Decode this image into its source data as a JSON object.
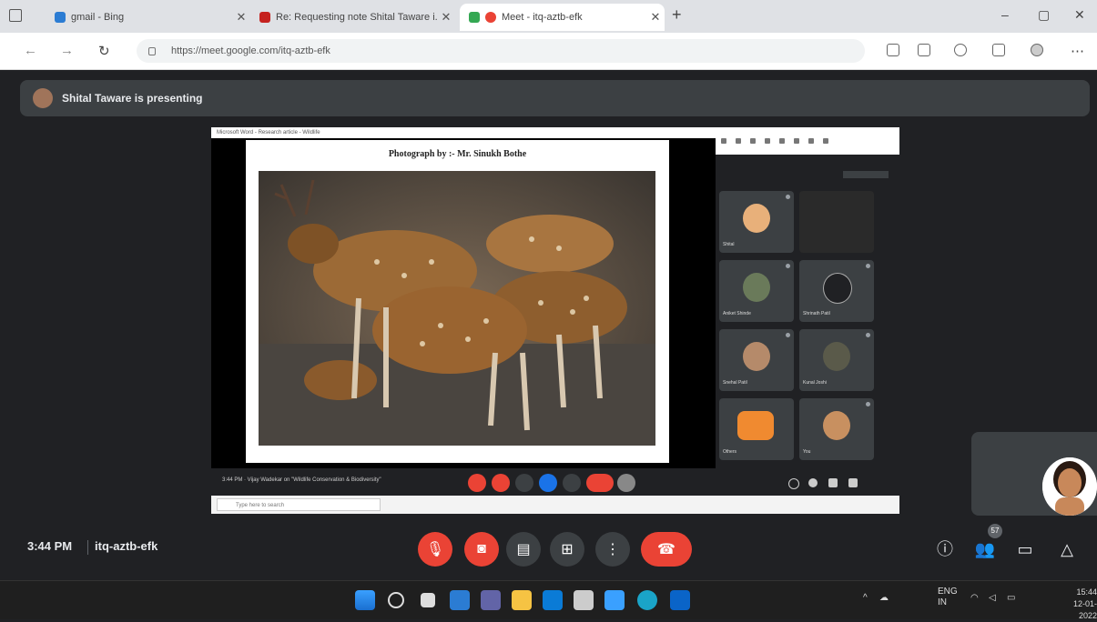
{
  "browser": {
    "tabs": [
      {
        "title": "gmail - Bing"
      },
      {
        "title": "Re: Requesting note Shital Taware i..."
      },
      {
        "title": "Meet - itq-aztb-efk"
      }
    ],
    "address": "https://meet.google.com/itq-aztb-efk"
  },
  "meet": {
    "presenting_text": "Shital Taware is presenting",
    "slide_caption": "Photograph by :- Mr. Sinukh Bothe",
    "time": "3:44 PM",
    "meeting_code": "itq-aztb-efk",
    "participant_count": "57"
  },
  "inner": {
    "window_title": "Microsoft Word - Research article - Wildlife",
    "strip_text": "3:44 PM  ·  Vijay Wadekar on \"Wildlife Conservation & Biodiversity\"",
    "search_placeholder": "Type here to search",
    "tiles": [
      {
        "name": "Shital"
      },
      {
        "name": ""
      },
      {
        "name": "Aniket Shinde"
      },
      {
        "name": "Shrinath Patil"
      },
      {
        "name": "Snehal Patil"
      },
      {
        "name": "Kunal Joshi"
      },
      {
        "name": "Others"
      },
      {
        "name": "You"
      }
    ]
  },
  "taskbar": {
    "lang": "ENG",
    "region": "IN",
    "clock_time": "15:44",
    "clock_date": "12-01-2022"
  },
  "colors": {
    "red": "#ea4335",
    "meet_bg": "#202124",
    "tile": "#3c4043"
  }
}
